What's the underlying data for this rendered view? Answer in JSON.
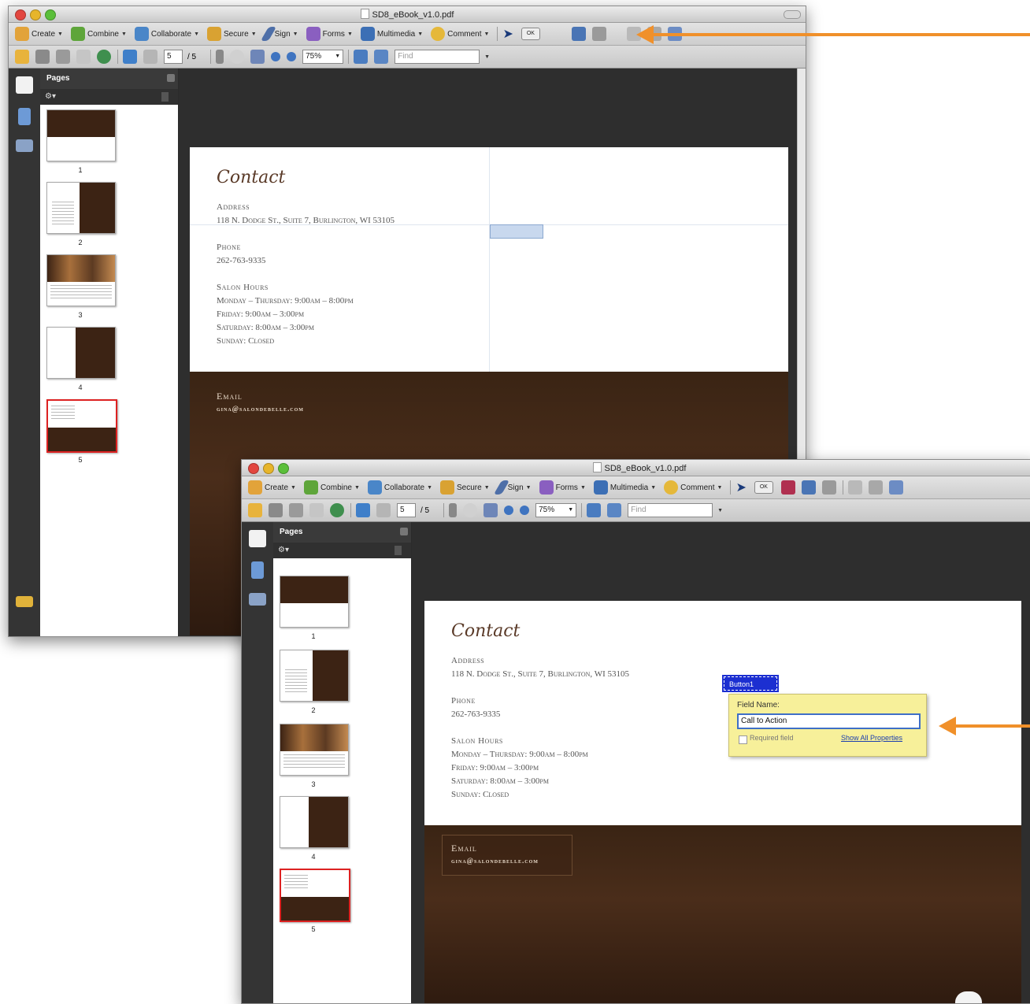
{
  "window_back": {
    "title": "SD8_eBook_v1.0.pdf",
    "toolbar": {
      "create": "Create",
      "combine": "Combine",
      "collaborate": "Collaborate",
      "secure": "Secure",
      "sign": "Sign",
      "forms": "Forms",
      "multimedia": "Multimedia",
      "comment": "Comment",
      "ok_button": "OK"
    },
    "nav": {
      "page": "5",
      "total": "/ 5",
      "zoom": "75%",
      "find_placeholder": "Find"
    },
    "panel_title": "Pages",
    "thumb_numbers": [
      "1",
      "2",
      "3",
      "4",
      "5"
    ]
  },
  "window_front": {
    "title": "SD8_eBook_v1.0.pdf",
    "toolbar": {
      "create": "Create",
      "combine": "Combine",
      "collaborate": "Collaborate",
      "secure": "Secure",
      "sign": "Sign",
      "forms": "Forms",
      "multimedia": "Multimedia",
      "comment": "Comment",
      "ok_button": "OK"
    },
    "nav": {
      "page": "5",
      "total": "/ 5",
      "zoom": "75%",
      "find_placeholder": "Find"
    },
    "panel_title": "Pages",
    "thumb_numbers": [
      "1",
      "2",
      "3",
      "4",
      "5"
    ],
    "form_button_label": "Button1",
    "popup": {
      "field_name_label": "Field Name:",
      "field_name_value": "Call to Action",
      "required_label": "Required field",
      "show_all_link": "Show All Properties"
    }
  },
  "contact": {
    "title": "Contact",
    "address_label": "Address",
    "address": "118 N. Dodge St., Suite 7, Burlington, WI 53105",
    "phone_label": "Phone",
    "phone": "262-763-9335",
    "hours_label": "Salon Hours",
    "hours": [
      "Monday – Thursday: 9:00am – 8:00pm",
      "Friday: 9:00am – 3:00pm",
      "Saturday: 8:00am – 3:00pm",
      "Sunday: Closed"
    ],
    "email_label": "Email",
    "email": "gina@salondebelle.com"
  },
  "colors": {
    "arrow": "#f0902a",
    "selected_thumb_border": "#d22222",
    "popup_bg": "#f7f09a",
    "brown_footer": "#3a2414"
  }
}
